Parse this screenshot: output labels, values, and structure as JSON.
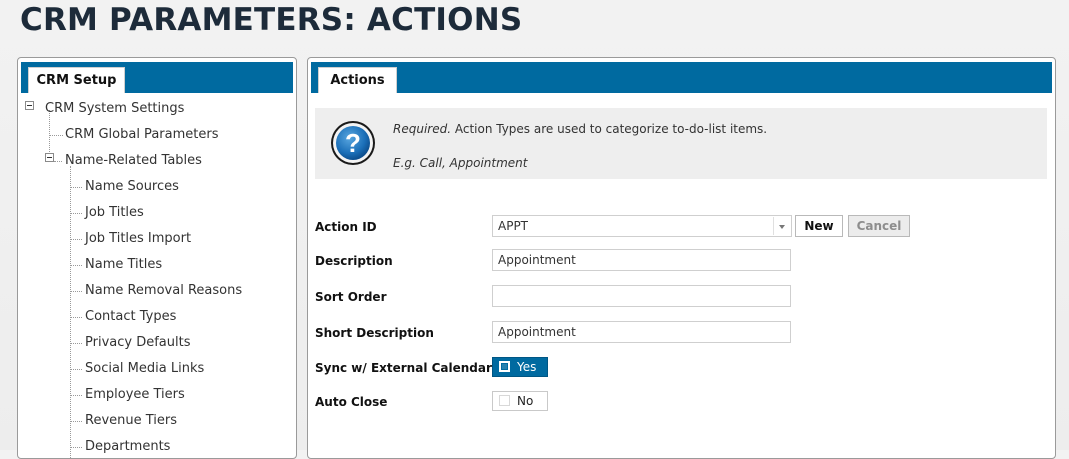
{
  "page": {
    "title": "CRM PARAMETERS: ACTIONS"
  },
  "left_panel": {
    "tab_label": "CRM Setup",
    "tree": {
      "root": "CRM System Settings",
      "global_params": "CRM Global Parameters",
      "name_related": "Name-Related Tables",
      "children": [
        "Name Sources",
        "Job Titles",
        "Job Titles Import",
        "Name Titles",
        "Name Removal Reasons",
        "Contact Types",
        "Privacy Defaults",
        "Social Media Links",
        "Employee Tiers",
        "Revenue Tiers",
        "Departments"
      ]
    }
  },
  "right_panel": {
    "tab_label": "Actions",
    "info": {
      "required": "Required.",
      "line1_rest": " Action Types are used to categorize to-do-list items.",
      "example": "E.g. Call, Appointment"
    },
    "form": {
      "action_id": {
        "label": "Action ID",
        "value": "APPT"
      },
      "new_button": "New",
      "cancel_button": "Cancel",
      "description": {
        "label": "Description",
        "value": "Appointment"
      },
      "sort_order": {
        "label": "Sort Order",
        "value": ""
      },
      "short_description": {
        "label": "Short Description",
        "value": "Appointment"
      },
      "sync_calendar": {
        "label": "Sync w/ External Calendar",
        "value": "Yes",
        "checked": true
      },
      "auto_close": {
        "label": "Auto Close",
        "value": "No",
        "checked": false
      }
    }
  },
  "colors": {
    "accent": "#006aa0",
    "title": "#1d2b3a",
    "info_background": "#eeeeee"
  },
  "icons": {
    "help": "question-mark-circle-icon",
    "tree_toggle": "collapse-minus-icon"
  }
}
